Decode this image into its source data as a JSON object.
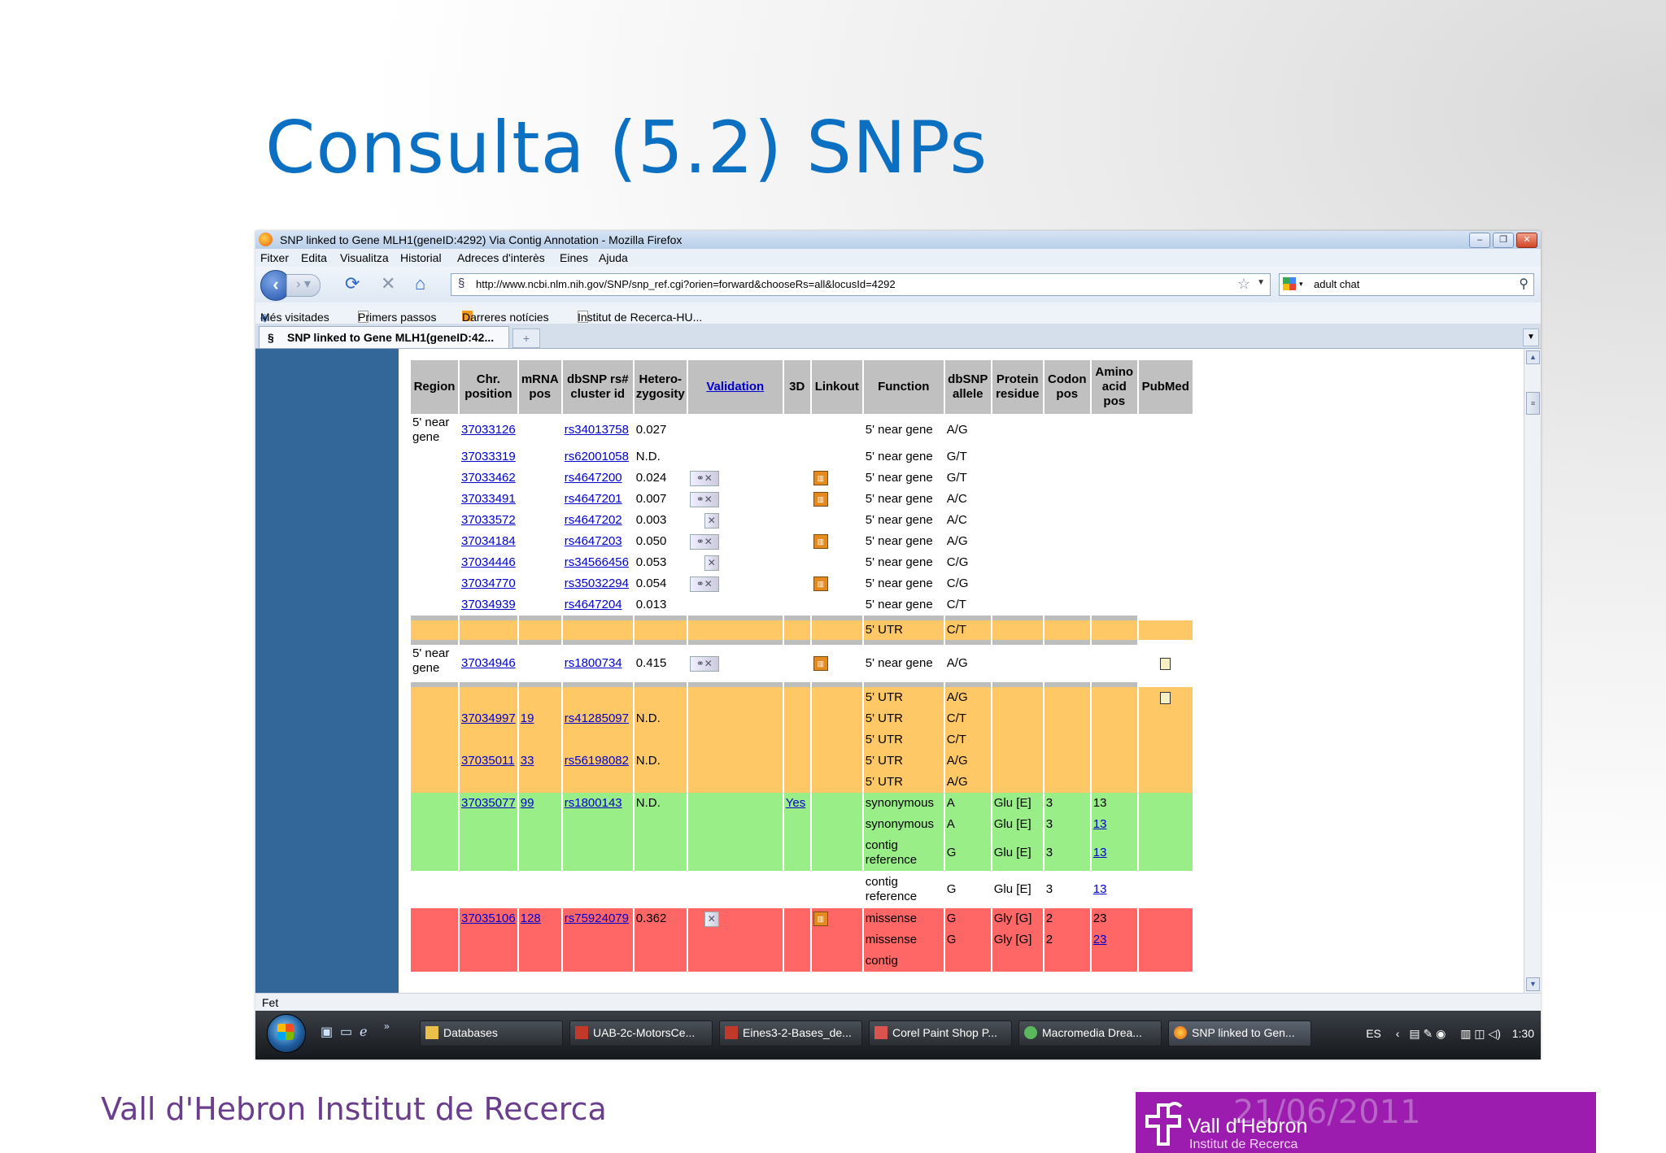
{
  "slide": {
    "title": "Consulta (5.2) SNPs",
    "footer": "Vall d'Hebron Institut de Recerca",
    "logo": {
      "date": "21/06/2011",
      "name": "Vall d'Hebron",
      "subtitle": "Institut de Recerca"
    }
  },
  "browser": {
    "window_title": "SNP linked to Gene MLH1(geneID:4292) Via Contig Annotation - Mozilla Firefox",
    "menu": [
      "Fitxer",
      "Edita",
      "Visualitza",
      "Historial",
      "Adreces d'interès",
      "Eines",
      "Ajuda"
    ],
    "url": "http://www.ncbi.nlm.nih.gov/SNP/snp_ref.cgi?orien=forward&chooseRs=all&locusId=4292",
    "search_value": "adult chat",
    "bookmarks": [
      "Més visitades",
      "Primers passos",
      "Darreres notícies",
      "Institut de Recerca-HU..."
    ],
    "tab_title": "SNP linked to Gene MLH1(geneID:42...",
    "status": "Fet"
  },
  "table": {
    "headers": {
      "region": "Region",
      "chr": "Chr. position",
      "mrna": "mRNA pos",
      "rs": "dbSNP rs# cluster id",
      "het": "Hetero-zygosity",
      "validation": "Validation",
      "threed": "3D",
      "linkout": "Linkout",
      "function": "Function",
      "allele": "dbSNP allele",
      "protein": "Protein residue",
      "codon": "Codon pos",
      "aa": "Amino acid pos",
      "pubmed": "PubMed"
    },
    "region_label": "5' near gene",
    "rows_a": [
      {
        "chr": "37033126",
        "rs": "rs34013758",
        "het": "0.027",
        "func": "5' near gene",
        "allele": "A/G",
        "val": "",
        "link": false
      },
      {
        "chr": "37033319",
        "rs": "rs62001058",
        "het": "N.D.",
        "func": "5' near gene",
        "allele": "G/T",
        "val": "",
        "link": false
      },
      {
        "chr": "37033462",
        "rs": "rs4647200",
        "het": "0.024",
        "func": "5' near gene",
        "allele": "G/T",
        "val": "x",
        "link": true
      },
      {
        "chr": "37033491",
        "rs": "rs4647201",
        "het": "0.007",
        "func": "5' near gene",
        "allele": "A/C",
        "val": "x",
        "link": true
      },
      {
        "chr": "37033572",
        "rs": "rs4647202",
        "het": "0.003",
        "func": "5' near gene",
        "allele": "A/C",
        "val": "s",
        "link": false
      },
      {
        "chr": "37034184",
        "rs": "rs4647203",
        "het": "0.050",
        "func": "5' near gene",
        "allele": "A/G",
        "val": "x",
        "link": true
      },
      {
        "chr": "37034446",
        "rs": "rs34566456",
        "het": "0.053",
        "func": "5' near gene",
        "allele": "C/G",
        "val": "s",
        "link": false
      },
      {
        "chr": "37034770",
        "rs": "rs35032294",
        "het": "0.054",
        "func": "5' near gene",
        "allele": "C/G",
        "val": "x",
        "link": true
      },
      {
        "chr": "37034939",
        "rs": "rs4647204",
        "het": "0.013",
        "func": "5' near gene",
        "allele": "C/T",
        "val": "",
        "link": false
      }
    ],
    "utr_row": {
      "func": "5' UTR",
      "allele": "C/T"
    },
    "row_b": {
      "chr": "37034946",
      "rs": "rs1800734",
      "het": "0.415",
      "func": "5' near gene",
      "allele": "A/G"
    },
    "orange_rows": [
      {
        "chr": "",
        "mrna": "",
        "rs": "",
        "het": "",
        "func": "5' UTR",
        "allele": "A/G",
        "pub": true
      },
      {
        "chr": "37034997",
        "mrna": "19",
        "rs": "rs41285097",
        "het": "N.D.",
        "func": "5' UTR",
        "allele": "C/T",
        "pub": false
      },
      {
        "chr": "",
        "mrna": "",
        "rs": "",
        "het": "",
        "func": "5' UTR",
        "allele": "C/T",
        "pub": false
      },
      {
        "chr": "37035011",
        "mrna": "33",
        "rs": "rs56198082",
        "het": "N.D.",
        "func": "5' UTR",
        "allele": "A/G",
        "pub": false
      },
      {
        "chr": "",
        "mrna": "",
        "rs": "",
        "het": "",
        "func": "5' UTR",
        "allele": "A/G",
        "pub": false
      }
    ],
    "green_rows": [
      {
        "chr": "37035077",
        "mrna": "99",
        "rs": "rs1800143",
        "het": "N.D.",
        "threed": "Yes",
        "func": "synonymous",
        "allele": "A",
        "prot": "Glu [E]",
        "codon": "3",
        "aa": "13",
        "aa_link": false
      },
      {
        "chr": "",
        "mrna": "",
        "rs": "",
        "het": "",
        "threed": "",
        "func": "synonymous",
        "allele": "A",
        "prot": "Glu [E]",
        "codon": "3",
        "aa": "13",
        "aa_link": true
      },
      {
        "chr": "",
        "mrna": "",
        "rs": "",
        "het": "",
        "threed": "",
        "func": "contig reference",
        "allele": "G",
        "prot": "Glu [E]",
        "codon": "3",
        "aa": "13",
        "aa_link": true
      }
    ],
    "white_row": {
      "func": "contig reference",
      "allele": "G",
      "prot": "Glu [E]",
      "codon": "3",
      "aa": "13"
    },
    "red_rows": [
      {
        "chr": "37035106",
        "mrna": "128",
        "rs": "rs75924079",
        "het": "0.362",
        "func": "missense",
        "allele": "G",
        "prot": "Gly [G]",
        "codon": "2",
        "aa": "23",
        "aa_link": false
      },
      {
        "chr": "",
        "mrna": "",
        "rs": "",
        "het": "",
        "func": "missense",
        "allele": "G",
        "prot": "Gly [G]",
        "codon": "2",
        "aa": "23",
        "aa_link": true
      },
      {
        "chr": "",
        "mrna": "",
        "rs": "",
        "het": "",
        "func": "contig",
        "allele": "",
        "prot": "",
        "codon": "",
        "aa": "",
        "aa_link": false
      }
    ]
  },
  "taskbar": {
    "items": [
      "Databases",
      "UAB-2c-MotorsCe...",
      "Eines3-2-Bases_de...",
      "Corel Paint Shop P...",
      "Macromedia Drea...",
      "SNP linked to Gen..."
    ],
    "lang": "ES",
    "time": "1:30"
  },
  "colors": {
    "title": "#0b6fc2",
    "footer": "#6a3e8c",
    "logo_bg": "#9b1cae",
    "orange": "#ffc866",
    "green": "#99ee88",
    "red": "#ff6666",
    "sidebar": "#336699"
  }
}
